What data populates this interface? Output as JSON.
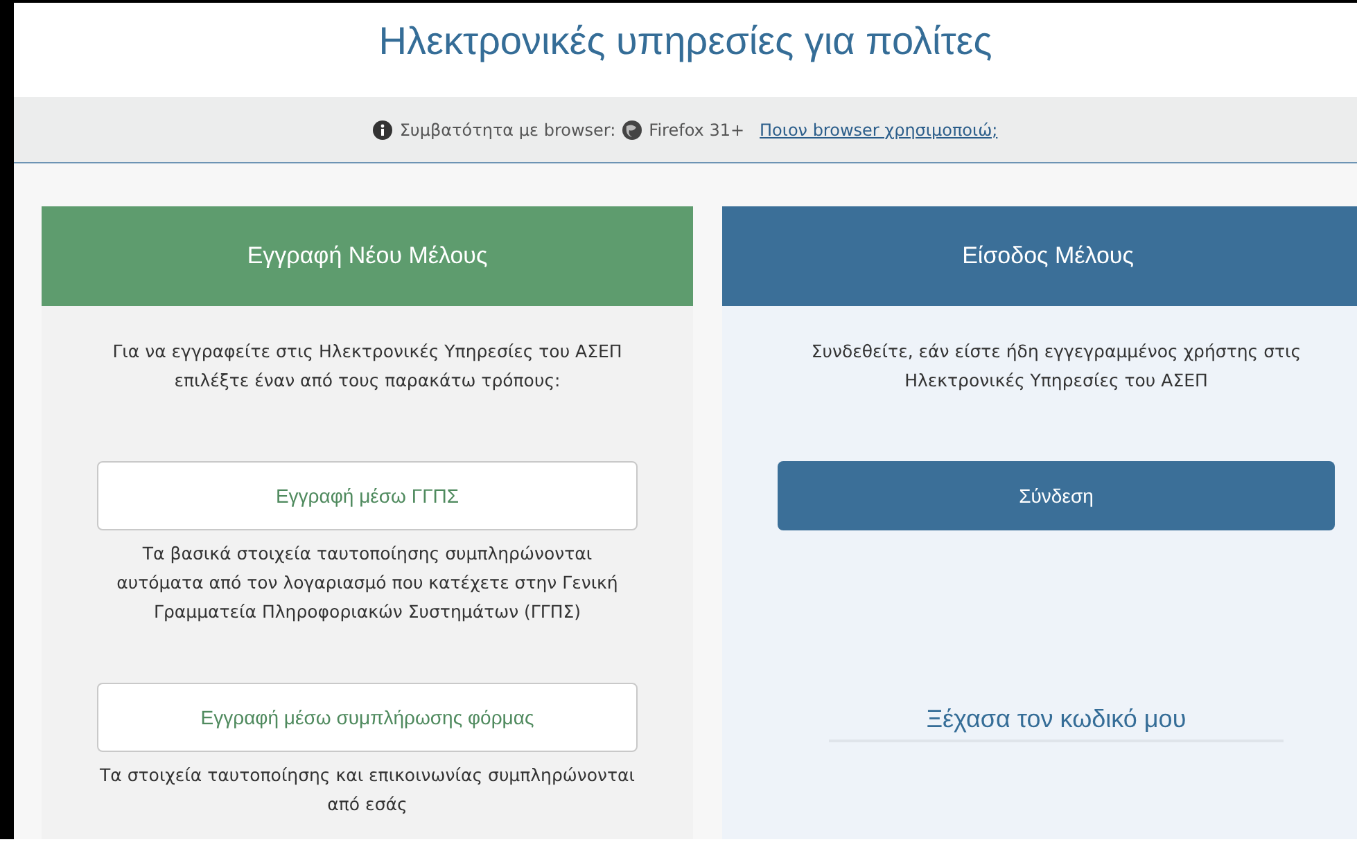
{
  "page": {
    "title": "Ηλεκτρονικές υπηρεσίες για πολίτες"
  },
  "compatibility": {
    "label": "Συμβατότητα με browser:",
    "browser": "Firefox 31+",
    "link": "Ποιον browser χρησιμοποιώ;"
  },
  "panels": [
    {
      "kind": "register",
      "title": "Εγγραφή Νέου Μέλους",
      "intro": "Για να εγγραφείτε στις Ηλεκτρονικές Υπηρεσίες του ΑΣΕΠ επιλέξτε έναν από τους παρακάτω τρόπους:",
      "options": [
        {
          "button": "Εγγραφή μέσω ΓΓΠΣ",
          "description": "Τα βασικά στοιχεία ταυτοποίησης συμπληρώνονται αυτόματα από τον λογαριασμό που κατέχετε στην Γενική Γραμματεία Πληροφοριακών Συστημάτων (ΓΓΠΣ)"
        },
        {
          "button": "Εγγραφή μέσω συμπλήρωσης φόρμας",
          "description": "Τα στοιχεία ταυτοποίησης και επικοινωνίας συμπληρώνονται από εσάς"
        }
      ]
    },
    {
      "kind": "login",
      "title": "Είσοδος Μέλους",
      "intro": "Συνδεθείτε, εάν είστε ήδη εγγεγραμμένος χρήστης στις Ηλεκτρονικές Υπηρεσίες του ΑΣΕΠ",
      "button": "Σύνδεση",
      "link": "Ξέχασα τον κωδικό μου"
    }
  ]
}
